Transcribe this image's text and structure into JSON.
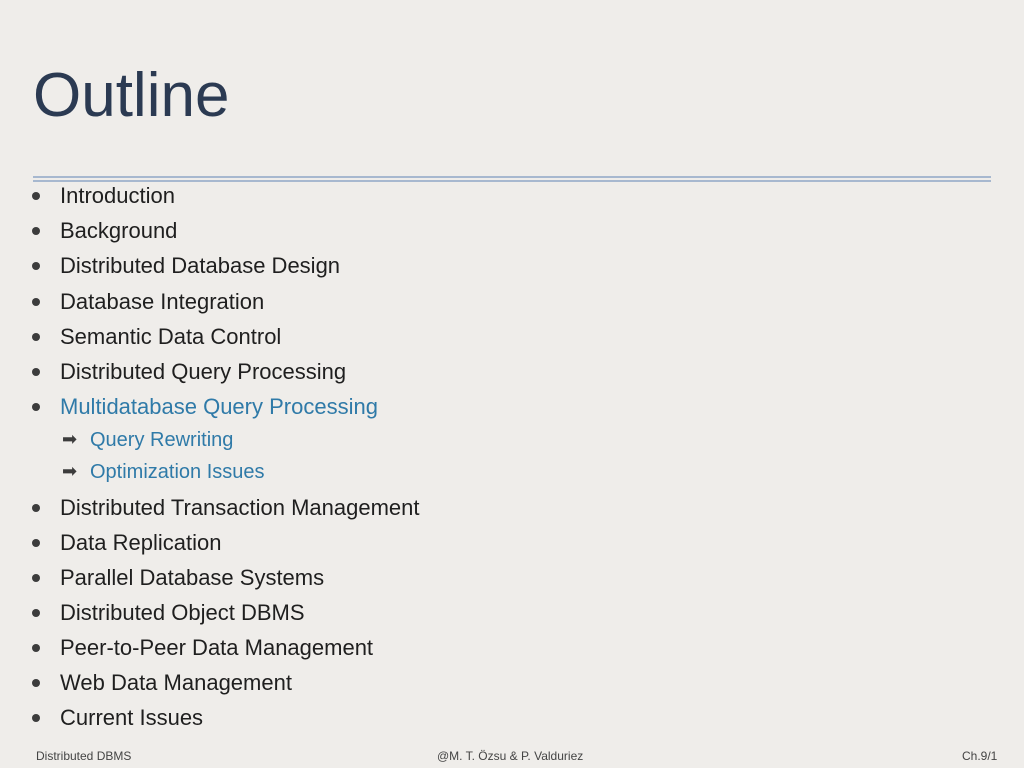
{
  "slide": {
    "title": "Outline",
    "items": [
      {
        "label": "Introduction"
      },
      {
        "label": "Background"
      },
      {
        "label": "Distributed Database Design"
      },
      {
        "label": "Database Integration"
      },
      {
        "label": "Semantic Data Control"
      },
      {
        "label": "Distributed Query Processing"
      },
      {
        "label": "Multidatabase Query Processing"
      }
    ],
    "subitems": [
      {
        "label": "Query Rewriting"
      },
      {
        "label": "Optimization Issues"
      }
    ],
    "items_after": [
      {
        "label": "Distributed Transaction Management"
      },
      {
        "label": "Data Replication"
      },
      {
        "label": "Parallel Database Systems"
      },
      {
        "label": "Distributed Object DBMS"
      },
      {
        "label": "Peer-to-Peer Data Management"
      },
      {
        "label": "Web Data Management"
      },
      {
        "label": "Current Issues"
      }
    ],
    "sub_marker": "➡",
    "colors": {
      "title": "#2b3a52",
      "active": "#2f7aa8",
      "rule": "#a7b8cf",
      "background": "#efedea"
    }
  },
  "footer": {
    "left": "Distributed DBMS",
    "center": "@M. T. Özsu & P. Valduriez",
    "right": "Ch.9/1"
  }
}
